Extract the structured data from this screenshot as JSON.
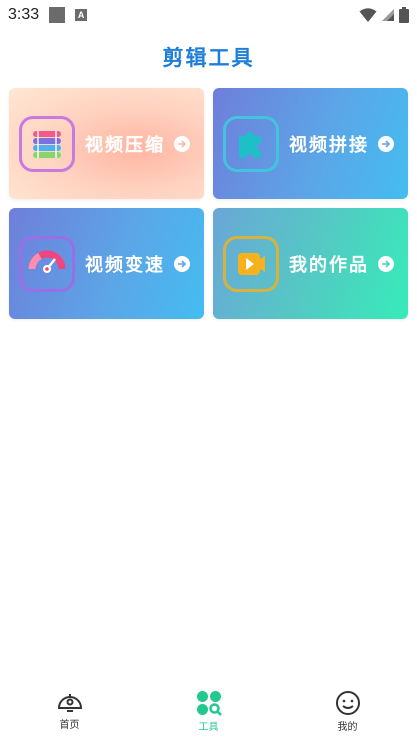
{
  "status_bar": {
    "time": "3:33",
    "notification_letter": "A"
  },
  "header": {
    "title": "剪辑工具"
  },
  "cards": [
    {
      "id": "compress",
      "label": "视频压缩",
      "icon": "layers-icon"
    },
    {
      "id": "merge",
      "label": "视频拼接",
      "icon": "puzzle-icon"
    },
    {
      "id": "speed",
      "label": "视频变速",
      "icon": "speedometer-icon"
    },
    {
      "id": "works",
      "label": "我的作品",
      "icon": "play-icon"
    }
  ],
  "bottom_nav": {
    "items": [
      {
        "label": "首页",
        "icon": "home-icon"
      },
      {
        "label": "工具",
        "icon": "tools-icon",
        "active": true
      },
      {
        "label": "我的",
        "icon": "profile-icon"
      }
    ]
  },
  "colors": {
    "title": "#1f7fd8",
    "active_tab": "#22c98f"
  }
}
